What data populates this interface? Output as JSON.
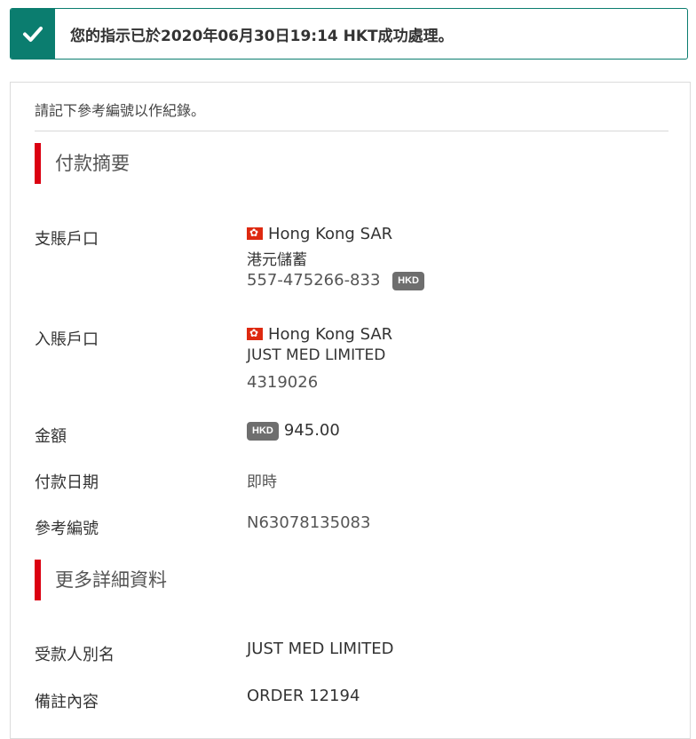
{
  "banner": {
    "icon": "check-icon",
    "message": "您的指示已於2020年06月30日19:14 HKT成功處理。",
    "color": "#0b7d6f"
  },
  "card": {
    "note": "請記下參考編號以作紀錄。",
    "accent": "#db0011",
    "summary": {
      "title": "付款摘要",
      "debit_label": "支賬戶口",
      "debit_region": "Hong Kong SAR",
      "debit_type": "港元儲蓄",
      "debit_number": "557-475266-833",
      "debit_currency": "HKD",
      "credit_label": "入賬戶口",
      "credit_region": "Hong Kong SAR",
      "credit_name": "JUST MED LIMITED",
      "credit_number": "4319026",
      "amount_label": "金額",
      "amount_currency": "HKD",
      "amount_value": "945.00",
      "date_label": "付款日期",
      "date_value": "即時",
      "ref_label": "參考編號",
      "ref_value": "N63078135083"
    },
    "details": {
      "title": "更多詳細資料",
      "alias_label": "受款人別名",
      "alias_value": "JUST MED LIMITED",
      "remarks_label": "備註內容",
      "remarks_value": "ORDER 12194"
    }
  }
}
